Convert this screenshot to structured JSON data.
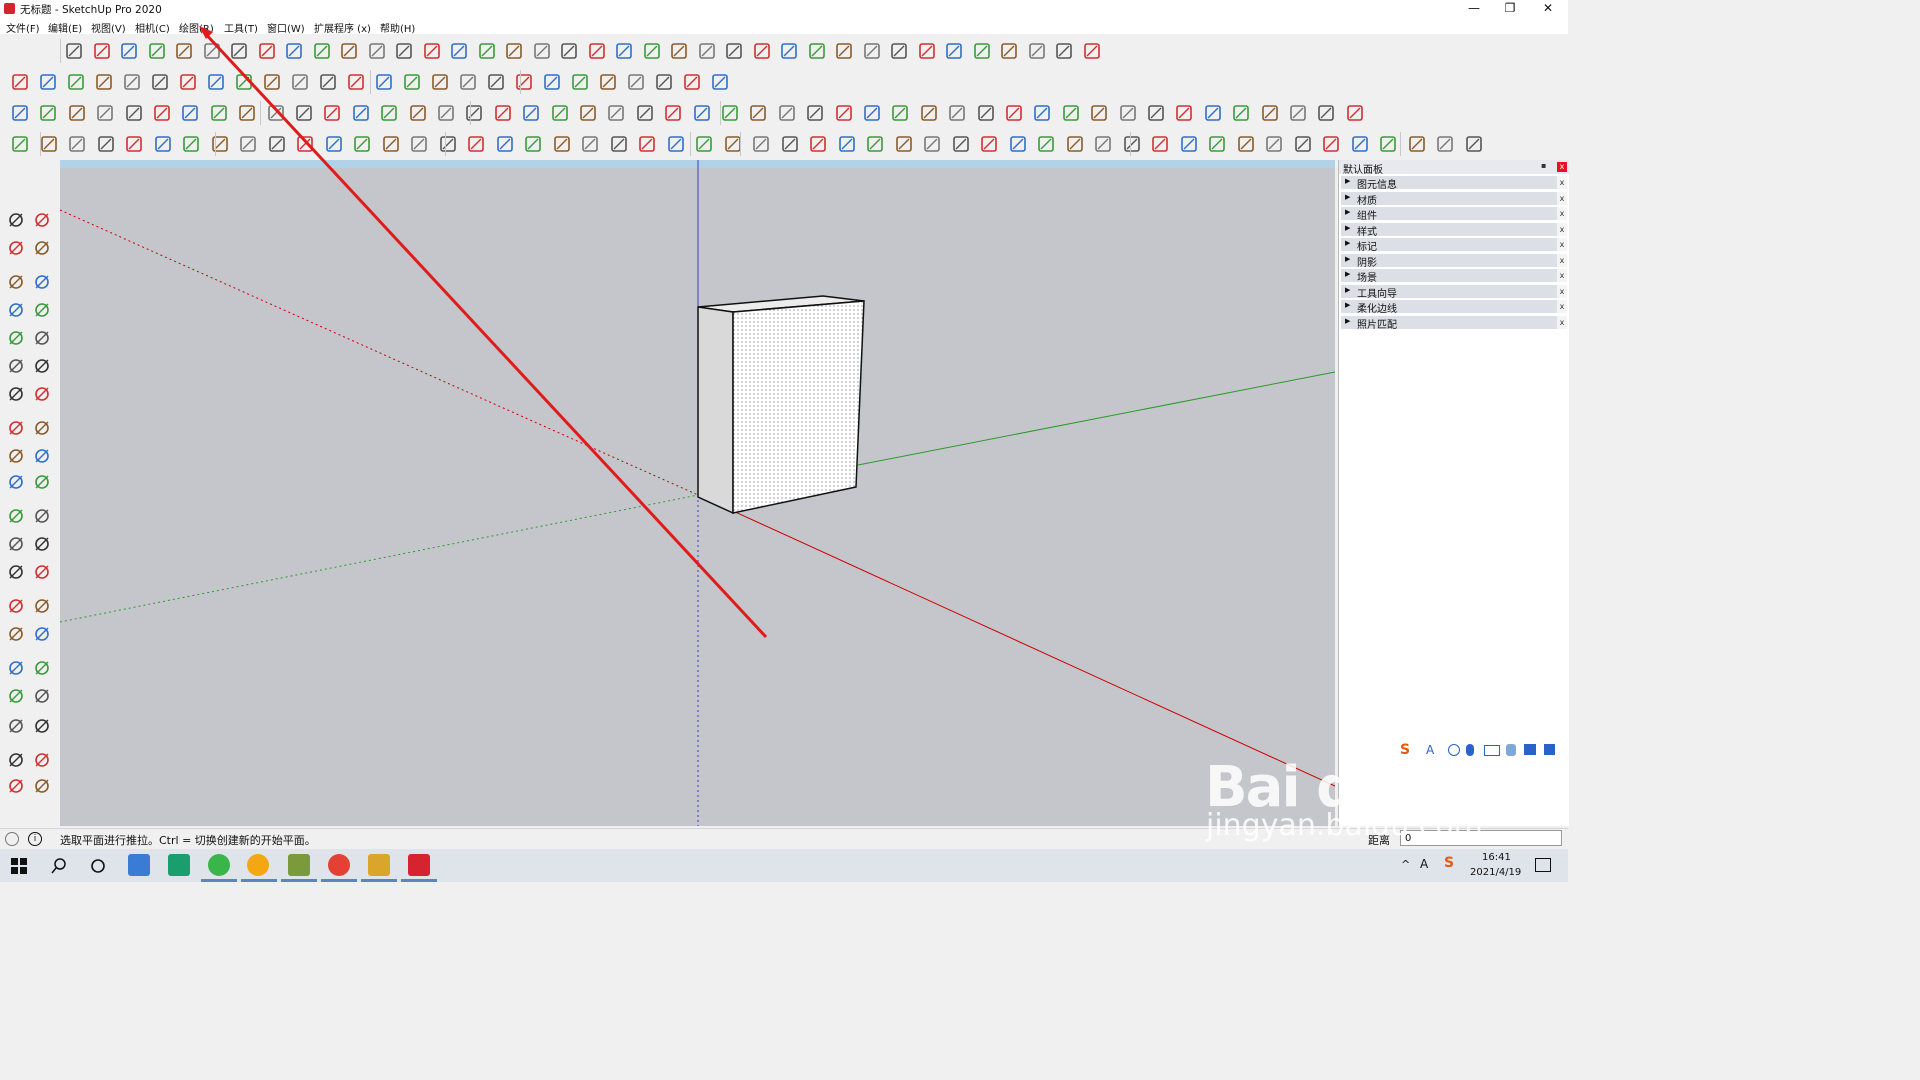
{
  "window": {
    "title": "无标题 - SketchUp Pro 2020",
    "minimize": "—",
    "maximize": "❐",
    "close": "✕"
  },
  "menu": [
    "文件(F)",
    "编辑(E)",
    "视图(V)",
    "相机(C)",
    "绘图(R)",
    "工具(T)",
    "窗口(W)",
    "扩展程序 (x)",
    "帮助(H)"
  ],
  "tray": {
    "title": "默认面板",
    "pin": "▪",
    "close": "x",
    "sections": [
      "图元信息",
      "材质",
      "组件",
      "样式",
      "标记",
      "阴影",
      "场景",
      "工具向导",
      "柔化边线",
      "照片匹配"
    ]
  },
  "status": {
    "message": "选取平面进行推拉。Ctrl = 切换创建新的开始平面。",
    "measure_label": "距离",
    "measure_value": "0"
  },
  "clock": {
    "time": "16:41",
    "date": "2021/4/19"
  },
  "watermark": {
    "brand": "Bai du 经验",
    "url": "jingyan.baidu.com"
  },
  "colors": {
    "accent_red": "#e01b1b",
    "axis_red": "#cc0000",
    "axis_green": "#2a9a2a",
    "axis_blue": "#3b3bcc",
    "viewport_bg": "#c5c6cb"
  }
}
